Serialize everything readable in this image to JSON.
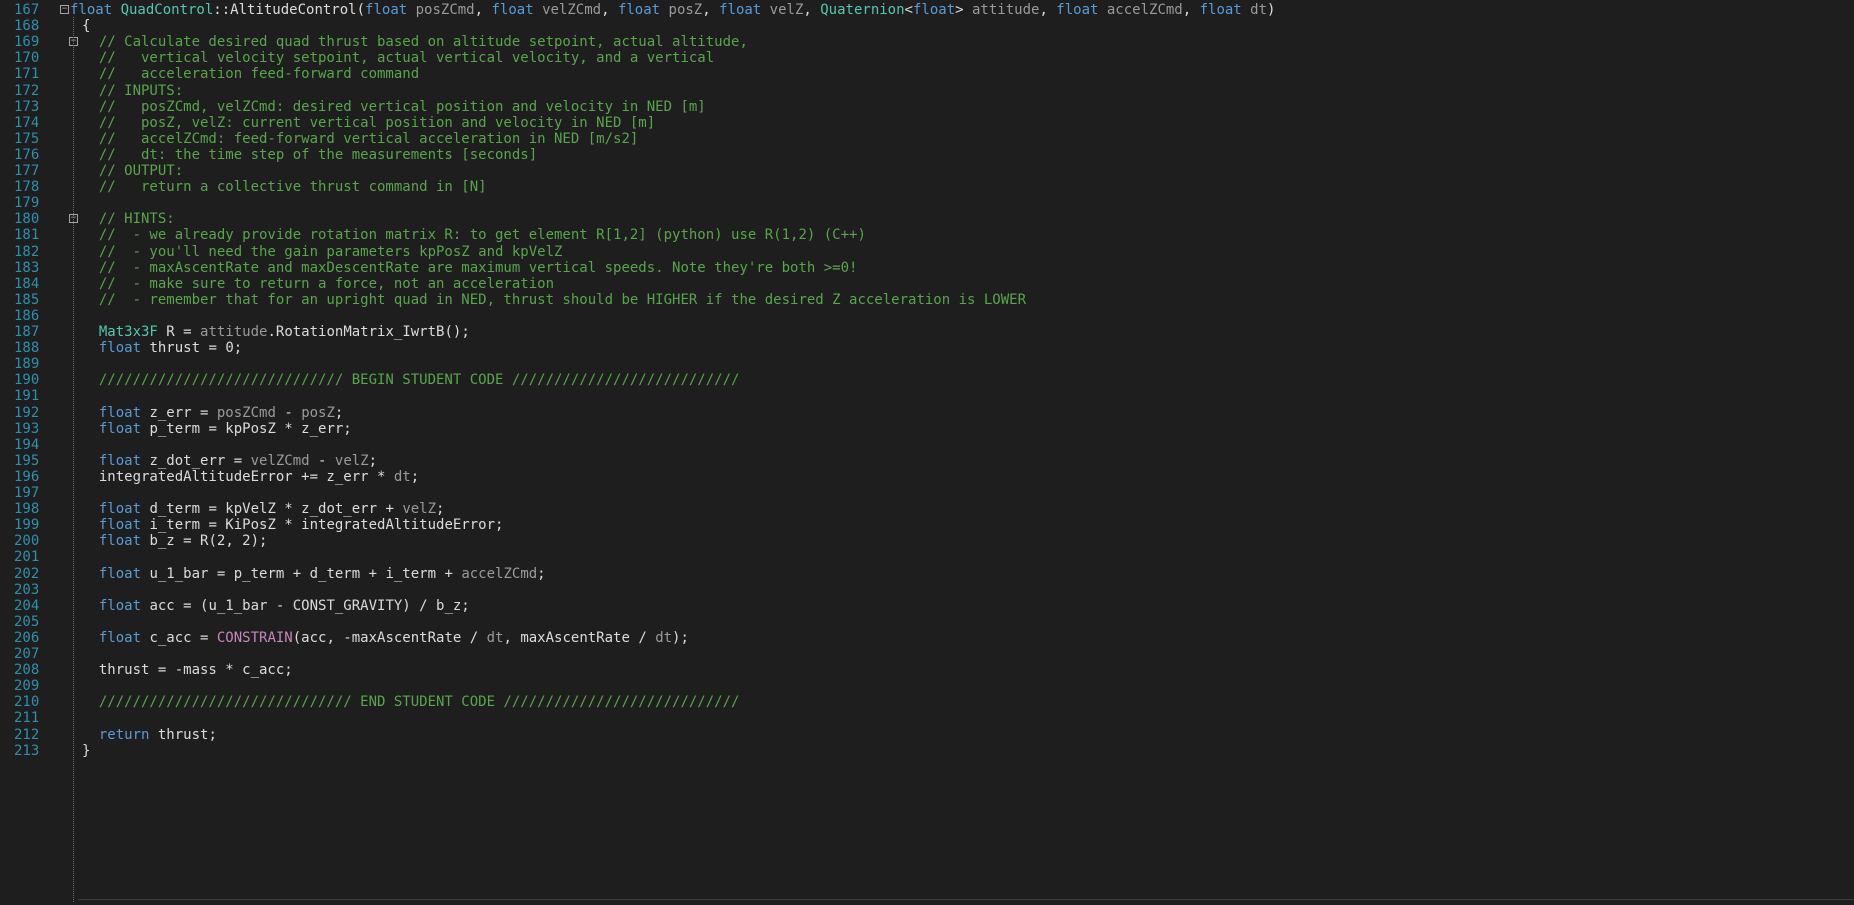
{
  "theme": {
    "background": "#1e1e1e",
    "line_number_color": "#2b91af",
    "keyword": "#569cd6",
    "type": "#4ec9b0",
    "comment": "#57a64a",
    "param": "#9a9a9a",
    "macro": "#c586c0",
    "text": "#dcdcdc"
  },
  "editor": {
    "lines": [
      {
        "n": "167",
        "fold": "minus",
        "tokens": [
          [
            "keyword",
            "float "
          ],
          [
            "type",
            "QuadControl"
          ],
          [
            "plain",
            "::"
          ],
          [
            "func",
            "AltitudeControl"
          ],
          [
            "plain",
            "("
          ],
          [
            "keyword",
            "float "
          ],
          [
            "param",
            "posZCmd"
          ],
          [
            "plain",
            ", "
          ],
          [
            "keyword",
            "float "
          ],
          [
            "param",
            "velZCmd"
          ],
          [
            "plain",
            ", "
          ],
          [
            "keyword",
            "float "
          ],
          [
            "param",
            "posZ"
          ],
          [
            "plain",
            ", "
          ],
          [
            "keyword",
            "float "
          ],
          [
            "param",
            "velZ"
          ],
          [
            "plain",
            ", "
          ],
          [
            "type",
            "Quaternion"
          ],
          [
            "plain",
            "<"
          ],
          [
            "keyword",
            "float"
          ],
          [
            "plain",
            "> "
          ],
          [
            "param",
            "attitude"
          ],
          [
            "plain",
            ", "
          ],
          [
            "keyword",
            "float "
          ],
          [
            "param",
            "accelZCmd"
          ],
          [
            "plain",
            ", "
          ],
          [
            "keyword",
            "float "
          ],
          [
            "param",
            "dt"
          ],
          [
            "plain",
            ")"
          ]
        ]
      },
      {
        "n": "168",
        "fold": "",
        "tokens": [
          [
            "plain",
            "{"
          ]
        ]
      },
      {
        "n": "169",
        "fold": "minus",
        "tokens": [
          [
            "comment",
            "  // Calculate desired quad thrust based on altitude setpoint, actual altitude,"
          ]
        ]
      },
      {
        "n": "170",
        "fold": "",
        "tokens": [
          [
            "comment",
            "  //   vertical velocity setpoint, actual vertical velocity, and a vertical"
          ]
        ]
      },
      {
        "n": "171",
        "fold": "",
        "tokens": [
          [
            "comment",
            "  //   acceleration feed-forward command"
          ]
        ]
      },
      {
        "n": "172",
        "fold": "",
        "tokens": [
          [
            "comment",
            "  // INPUTS:"
          ]
        ]
      },
      {
        "n": "173",
        "fold": "",
        "tokens": [
          [
            "comment",
            "  //   posZCmd, velZCmd: desired vertical position and velocity in NED [m]"
          ]
        ]
      },
      {
        "n": "174",
        "fold": "",
        "tokens": [
          [
            "comment",
            "  //   posZ, velZ: current vertical position and velocity in NED [m]"
          ]
        ]
      },
      {
        "n": "175",
        "fold": "",
        "tokens": [
          [
            "comment",
            "  //   accelZCmd: feed-forward vertical acceleration in NED [m/s2]"
          ]
        ]
      },
      {
        "n": "176",
        "fold": "",
        "tokens": [
          [
            "comment",
            "  //   dt: the time step of the measurements [seconds]"
          ]
        ]
      },
      {
        "n": "177",
        "fold": "",
        "tokens": [
          [
            "comment",
            "  // OUTPUT:"
          ]
        ]
      },
      {
        "n": "178",
        "fold": "",
        "tokens": [
          [
            "comment",
            "  //   return a collective thrust command in [N]"
          ]
        ]
      },
      {
        "n": "179",
        "fold": "",
        "tokens": []
      },
      {
        "n": "180",
        "fold": "minus",
        "tokens": [
          [
            "comment",
            "  // HINTS:"
          ]
        ]
      },
      {
        "n": "181",
        "fold": "",
        "tokens": [
          [
            "comment",
            "  //  - we already provide rotation matrix R: to get element R[1,2] (python) use R(1,2) (C++)"
          ]
        ]
      },
      {
        "n": "182",
        "fold": "",
        "tokens": [
          [
            "comment",
            "  //  - you'll need the gain parameters kpPosZ and kpVelZ"
          ]
        ]
      },
      {
        "n": "183",
        "fold": "",
        "tokens": [
          [
            "comment",
            "  //  - maxAscentRate and maxDescentRate are maximum vertical speeds. Note they're both >=0!"
          ]
        ]
      },
      {
        "n": "184",
        "fold": "",
        "tokens": [
          [
            "comment",
            "  //  - make sure to return a force, not an acceleration"
          ]
        ]
      },
      {
        "n": "185",
        "fold": "",
        "tokens": [
          [
            "comment",
            "  //  - remember that for an upright quad in NED, thrust should be HIGHER if the desired Z acceleration is LOWER"
          ]
        ]
      },
      {
        "n": "186",
        "fold": "",
        "tokens": []
      },
      {
        "n": "187",
        "fold": "",
        "tokens": [
          [
            "plain",
            "  "
          ],
          [
            "type",
            "Mat3x3F"
          ],
          [
            "plain",
            " R = "
          ],
          [
            "param",
            "attitude"
          ],
          [
            "plain",
            ".RotationMatrix_IwrtB();"
          ]
        ]
      },
      {
        "n": "188",
        "fold": "",
        "tokens": [
          [
            "plain",
            "  "
          ],
          [
            "keyword",
            "float"
          ],
          [
            "plain",
            " thrust = "
          ],
          [
            "number",
            "0"
          ],
          [
            "plain",
            ";"
          ]
        ]
      },
      {
        "n": "189",
        "fold": "",
        "tokens": []
      },
      {
        "n": "190",
        "fold": "",
        "tokens": [
          [
            "comment",
            "  ///////////////////////////// BEGIN STUDENT CODE ///////////////////////////"
          ]
        ]
      },
      {
        "n": "191",
        "fold": "",
        "tokens": []
      },
      {
        "n": "192",
        "fold": "",
        "tokens": [
          [
            "plain",
            "  "
          ],
          [
            "keyword",
            "float"
          ],
          [
            "plain",
            " z_err = "
          ],
          [
            "param",
            "posZCmd"
          ],
          [
            "plain",
            " - "
          ],
          [
            "param",
            "posZ"
          ],
          [
            "plain",
            ";"
          ]
        ]
      },
      {
        "n": "193",
        "fold": "",
        "tokens": [
          [
            "plain",
            "  "
          ],
          [
            "keyword",
            "float"
          ],
          [
            "plain",
            " p_term = kpPosZ * z_err;"
          ]
        ]
      },
      {
        "n": "194",
        "fold": "",
        "tokens": []
      },
      {
        "n": "195",
        "fold": "",
        "tokens": [
          [
            "plain",
            "  "
          ],
          [
            "keyword",
            "float"
          ],
          [
            "plain",
            " z_dot_err = "
          ],
          [
            "param",
            "velZCmd"
          ],
          [
            "plain",
            " - "
          ],
          [
            "param",
            "velZ"
          ],
          [
            "plain",
            ";"
          ]
        ]
      },
      {
        "n": "196",
        "fold": "",
        "tokens": [
          [
            "plain",
            "  integratedAltitudeError += z_err * "
          ],
          [
            "param",
            "dt"
          ],
          [
            "plain",
            ";"
          ]
        ]
      },
      {
        "n": "197",
        "fold": "",
        "tokens": []
      },
      {
        "n": "198",
        "fold": "",
        "tokens": [
          [
            "plain",
            "  "
          ],
          [
            "keyword",
            "float"
          ],
          [
            "plain",
            " d_term = kpVelZ * z_dot_err + "
          ],
          [
            "param",
            "velZ"
          ],
          [
            "plain",
            ";"
          ]
        ]
      },
      {
        "n": "199",
        "fold": "",
        "tokens": [
          [
            "plain",
            "  "
          ],
          [
            "keyword",
            "float"
          ],
          [
            "plain",
            " i_term = KiPosZ * integratedAltitudeError;"
          ]
        ]
      },
      {
        "n": "200",
        "fold": "",
        "tokens": [
          [
            "plain",
            "  "
          ],
          [
            "keyword",
            "float"
          ],
          [
            "plain",
            " b_z = R("
          ],
          [
            "number",
            "2"
          ],
          [
            "plain",
            ", "
          ],
          [
            "number",
            "2"
          ],
          [
            "plain",
            ");"
          ]
        ]
      },
      {
        "n": "201",
        "fold": "",
        "tokens": []
      },
      {
        "n": "202",
        "fold": "",
        "tokens": [
          [
            "plain",
            "  "
          ],
          [
            "keyword",
            "float"
          ],
          [
            "plain",
            " u_1_bar = p_term + d_term + i_term + "
          ],
          [
            "param",
            "accelZCmd"
          ],
          [
            "plain",
            ";"
          ]
        ]
      },
      {
        "n": "203",
        "fold": "",
        "tokens": []
      },
      {
        "n": "204",
        "fold": "",
        "tokens": [
          [
            "plain",
            "  "
          ],
          [
            "keyword",
            "float"
          ],
          [
            "plain",
            " acc = (u_1_bar - CONST_GRAVITY) / b_z;"
          ]
        ]
      },
      {
        "n": "205",
        "fold": "",
        "tokens": []
      },
      {
        "n": "206",
        "fold": "",
        "tokens": [
          [
            "plain",
            "  "
          ],
          [
            "keyword",
            "float"
          ],
          [
            "plain",
            " c_acc = "
          ],
          [
            "macro",
            "CONSTRAIN"
          ],
          [
            "plain",
            "(acc, -maxAscentRate / "
          ],
          [
            "param",
            "dt"
          ],
          [
            "plain",
            ", maxAscentRate / "
          ],
          [
            "param",
            "dt"
          ],
          [
            "plain",
            ");"
          ]
        ]
      },
      {
        "n": "207",
        "fold": "",
        "tokens": []
      },
      {
        "n": "208",
        "fold": "",
        "tokens": [
          [
            "plain",
            "  thrust = -mass * c_acc;"
          ]
        ]
      },
      {
        "n": "209",
        "fold": "",
        "tokens": []
      },
      {
        "n": "210",
        "fold": "",
        "tokens": [
          [
            "comment",
            "  ////////////////////////////// END STUDENT CODE ////////////////////////////"
          ]
        ]
      },
      {
        "n": "211",
        "fold": "",
        "tokens": []
      },
      {
        "n": "212",
        "fold": "",
        "tokens": [
          [
            "plain",
            "  "
          ],
          [
            "keyword",
            "return"
          ],
          [
            "plain",
            " thrust;"
          ]
        ]
      },
      {
        "n": "213",
        "fold": "",
        "tokens": [
          [
            "plain",
            "}"
          ]
        ]
      }
    ]
  }
}
